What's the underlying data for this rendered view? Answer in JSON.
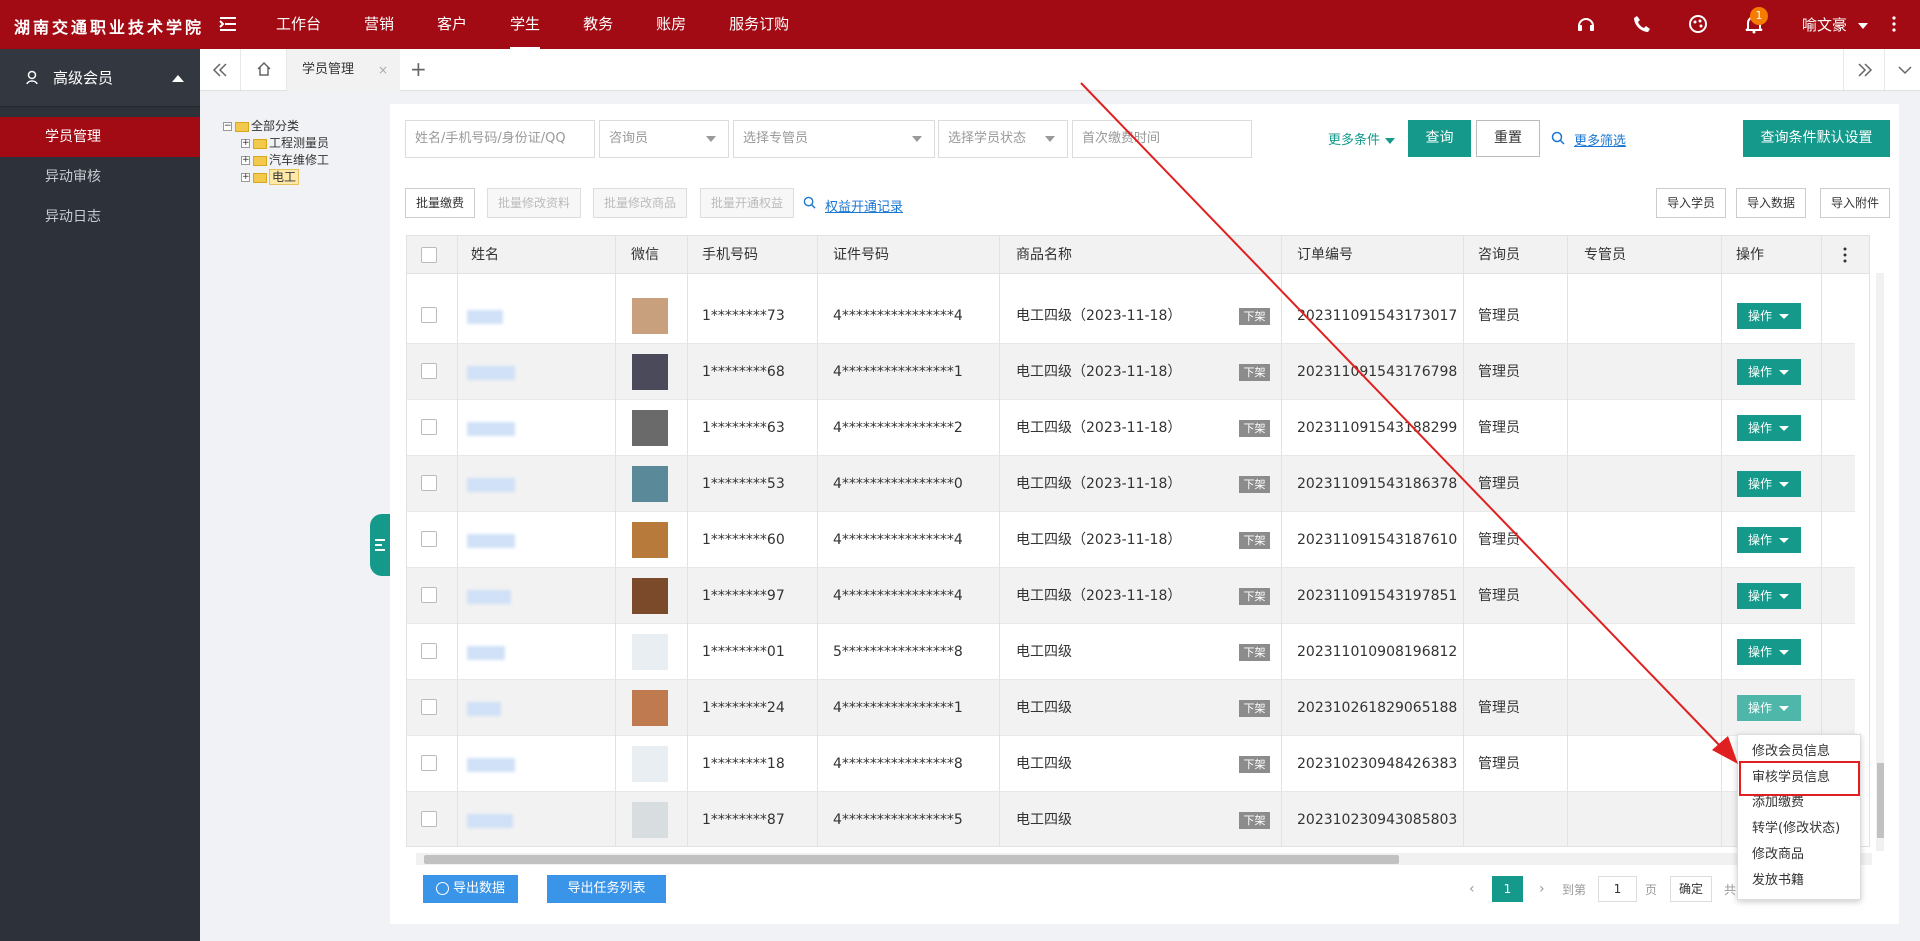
{
  "header": {
    "school_name": "湖南交通职业技术学院",
    "nav": [
      "工作台",
      "营销",
      "客户",
      "学生",
      "教务",
      "账房",
      "服务订购"
    ],
    "active_nav": "学生",
    "notification_count": "1",
    "user_name": "喻文豪"
  },
  "sidebar": {
    "member_label": "高级会员",
    "items": [
      "学员管理",
      "异动审核",
      "异动日志"
    ]
  },
  "tabs": {
    "current": "学员管理",
    "close": "×",
    "add": "+"
  },
  "tree": [
    "全部分类",
    "工程测量员",
    "汽车维修工",
    "电工"
  ],
  "search": {
    "name_placeholder": "姓名/手机号码/身份证/QQ",
    "consultant": "咨询员",
    "manager": "选择专管员",
    "status": "选择学员状态",
    "first_payment": "首次缴费时间",
    "more_conditions": "更多条件",
    "query": "查询",
    "reset": "重置",
    "more_filter": "更多筛选",
    "default_settings": "查询条件默认设置"
  },
  "toolbar": {
    "batch_pay": "批量缴费",
    "batch_edit_info": "批量修改资料",
    "batch_edit_goods": "批量修改商品",
    "batch_open_rights": "批量开通权益",
    "rights_record": "权益开通记录",
    "import_student": "导入学员",
    "import_data": "导入数据",
    "import_attachment": "导入附件"
  },
  "table": {
    "columns": [
      "姓名",
      "微信",
      "手机号码",
      "证件号码",
      "商品名称",
      "订单编号",
      "咨询员",
      "专管员",
      "操作"
    ],
    "rows": [
      {
        "phone": "1********73",
        "id": "4****************4",
        "product": "电工四级（2023-11-18）",
        "status": "下架",
        "order": "202311091543173017",
        "consultant": "管理员",
        "op": "操作"
      },
      {
        "phone": "1********68",
        "id": "4****************1",
        "product": "电工四级（2023-11-18）",
        "status": "下架",
        "order": "202311091543176798",
        "consultant": "管理员",
        "op": "操作"
      },
      {
        "phone": "1********63",
        "id": "4****************2",
        "product": "电工四级（2023-11-18）",
        "status": "下架",
        "order": "202311091543188299",
        "consultant": "管理员",
        "op": "操作"
      },
      {
        "phone": "1********53",
        "id": "4****************0",
        "product": "电工四级（2023-11-18）",
        "status": "下架",
        "order": "202311091543186378",
        "consultant": "管理员",
        "op": "操作"
      },
      {
        "phone": "1********60",
        "id": "4****************4",
        "product": "电工四级（2023-11-18）",
        "status": "下架",
        "order": "202311091543187610",
        "consultant": "管理员",
        "op": "操作"
      },
      {
        "phone": "1********97",
        "id": "4****************4",
        "product": "电工四级（2023-11-18）",
        "status": "下架",
        "order": "202311091543197851",
        "consultant": "管理员",
        "op": "操作"
      },
      {
        "phone": "1********01",
        "id": "5****************8",
        "product": "电工四级",
        "status": "下架",
        "order": "202311010908196812",
        "consultant": "",
        "op": "操作"
      },
      {
        "phone": "1********24",
        "id": "4****************1",
        "product": "电工四级",
        "status": "下架",
        "order": "202310261829065188",
        "consultant": "管理员",
        "op": "操作"
      },
      {
        "phone": "1********18",
        "id": "4****************8",
        "product": "电工四级",
        "status": "下架",
        "order": "202310230948426383",
        "consultant": "管理员",
        "op": ""
      },
      {
        "phone": "1********87",
        "id": "4****************5",
        "product": "电工四级",
        "status": "下架",
        "order": "202310230943085803",
        "consultant": "",
        "op": ""
      }
    ]
  },
  "dropdown": [
    "修改会员信息",
    "审核学员信息",
    "添加缴费",
    "转学(修改状态)",
    "修改商品",
    "发放书籍"
  ],
  "footer": {
    "export_data": "导出数据",
    "export_tasks": "导出任务列表",
    "page": "1",
    "goto": "到第",
    "page_input": "1",
    "page_unit": "页",
    "confirm": "确定",
    "total": "共"
  }
}
